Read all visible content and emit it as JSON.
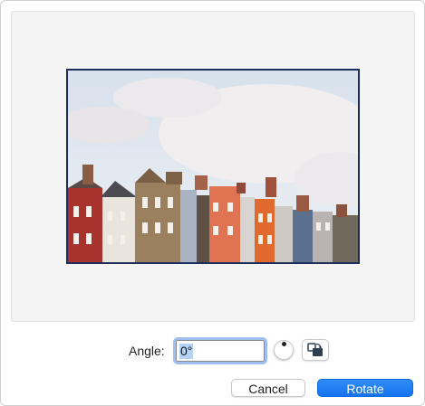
{
  "angle_row": {
    "label": "Angle:",
    "value": "0°"
  },
  "buttons": {
    "cancel_label": "Cancel",
    "rotate_label": "Rotate"
  },
  "icons": {
    "dial": "rotation-dial-icon",
    "rotate_step": "rotate-90-icon"
  },
  "colors": {
    "accent": "#1a78f2",
    "frame_border": "#1c2d5c",
    "focus_ring": "#9fbff0"
  }
}
